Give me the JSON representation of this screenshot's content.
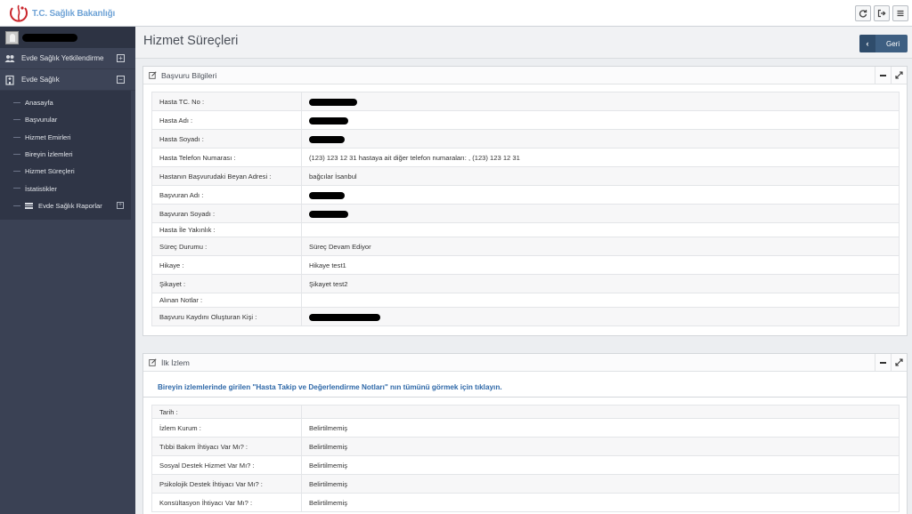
{
  "app": {
    "logo_text": "T.C. Sağlık Bakanlığı"
  },
  "colors": {
    "sidebar_bg": "#3a4154",
    "accent_blue": "#3e5f82",
    "link_blue": "#2e68a8",
    "logo_red": "#c9252b"
  },
  "topbar": {
    "buttons": [
      "refresh-icon",
      "logout-icon",
      "menu-icon"
    ]
  },
  "sidebar": {
    "menu": [
      {
        "label": "Evde Sağlık Yetkilendirme",
        "icon": "users-icon",
        "toggle": "+"
      },
      {
        "label": "Evde Sağlık",
        "icon": "building-icon",
        "toggle": "−"
      }
    ],
    "submenu": [
      {
        "label": "Anasayfa"
      },
      {
        "label": "Başvurular"
      },
      {
        "label": "Hizmet Emirleri"
      },
      {
        "label": "Bireyin İzlemleri"
      },
      {
        "label": "Hizmet Süreçleri"
      },
      {
        "label": "İstatistikler"
      },
      {
        "label": "Evde Sağlık Raporlar",
        "icon": "list-icon",
        "toggle": "+"
      }
    ]
  },
  "page": {
    "title": "Hizmet Süreçleri",
    "back_label": "Geri"
  },
  "panel1": {
    "title": "Başvuru Bilgileri",
    "rows": [
      {
        "label": "Hasta TC. No :",
        "value": ""
      },
      {
        "label": "Hasta Adı :",
        "value": ""
      },
      {
        "label": "Hasta Soyadı :",
        "value": ""
      },
      {
        "label": "Hasta Telefon Numarası :",
        "value": "(123) 123 12 31 hastaya ait diğer telefon numaraları: , (123) 123 12 31"
      },
      {
        "label": "Hastanın Başvurudaki Beyan Adresi :",
        "value": "bağcılar İsanbul"
      },
      {
        "label": "Başvuran Adı :",
        "value": ""
      },
      {
        "label": "Başvuran Soyadı :",
        "value": ""
      },
      {
        "label": "Hasta İle Yakınlık :",
        "value": ""
      },
      {
        "label": "Süreç Durumu :",
        "value": "Süreç Devam Ediyor"
      },
      {
        "label": "Hikaye :",
        "value": "Hikaye test1"
      },
      {
        "label": "Şikayet :",
        "value": "Şikayet test2"
      },
      {
        "label": "Alınan Notlar :",
        "value": ""
      },
      {
        "label": "Başvuru Kaydını Oluşturan Kişi :",
        "value": ""
      }
    ]
  },
  "panel2": {
    "title": "İlk İzlem",
    "notice": "Bireyin izlemlerinde girilen \"Hasta Takip ve Değerlendirme Notları\" nın tümünü görmek için tıklayın.",
    "rows": [
      {
        "label": "Tarih :",
        "value": ""
      },
      {
        "label": "İzlem Kurum :",
        "value": "Belirtilmemiş"
      },
      {
        "label": "Tıbbi Bakım İhtiyacı Var Mı? :",
        "value": "Belirtilmemiş"
      },
      {
        "label": "Sosyal Destek Hizmet Var Mı? :",
        "value": "Belirtilmemiş"
      },
      {
        "label": "Psikolojik Destek İhtiyacı Var Mı? :",
        "value": "Belirtilmemiş"
      },
      {
        "label": "Konsültasyon İhtiyacı Var Mı? :",
        "value": "Belirtilmemiş"
      }
    ]
  }
}
